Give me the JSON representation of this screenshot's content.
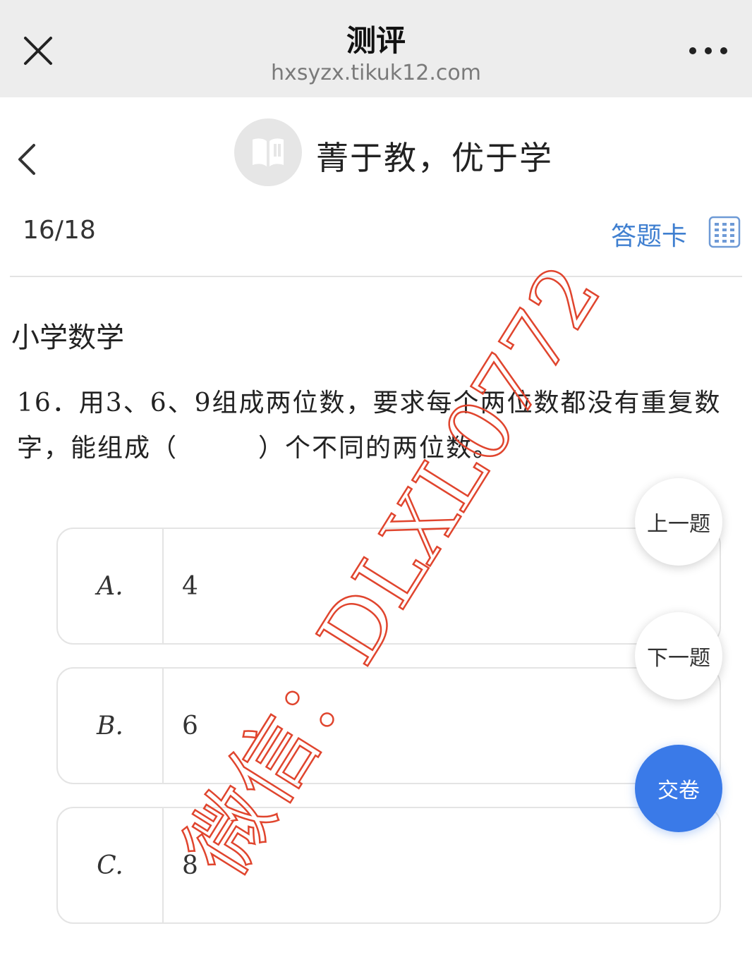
{
  "window": {
    "title": "测评",
    "url": "hxsyzx.tikuk12.com"
  },
  "header": {
    "brand": "菁于教，优于学"
  },
  "progress": {
    "current": "16/18",
    "answer_card_label": "答题卡"
  },
  "subject": "小学数学",
  "question": {
    "text": "16．用3、6、9组成两位数，要求每个两位数都没有重复数字，能组成（　　　）个不同的两位数。"
  },
  "options": [
    {
      "letter": "A.",
      "value": "4"
    },
    {
      "letter": "B.",
      "value": "6"
    },
    {
      "letter": "C.",
      "value": "8"
    }
  ],
  "nav": {
    "prev_label": "上一题",
    "next_label": "下一题",
    "submit_label": "交卷"
  },
  "watermark": {
    "text": "微信：DLXL0772",
    "color": "#e0452e"
  },
  "colors": {
    "accent": "#3a7ae8",
    "link": "#3f7fd0"
  },
  "icons": [
    "close-icon",
    "more-icon",
    "back-icon",
    "book-icon",
    "grid-icon"
  ]
}
